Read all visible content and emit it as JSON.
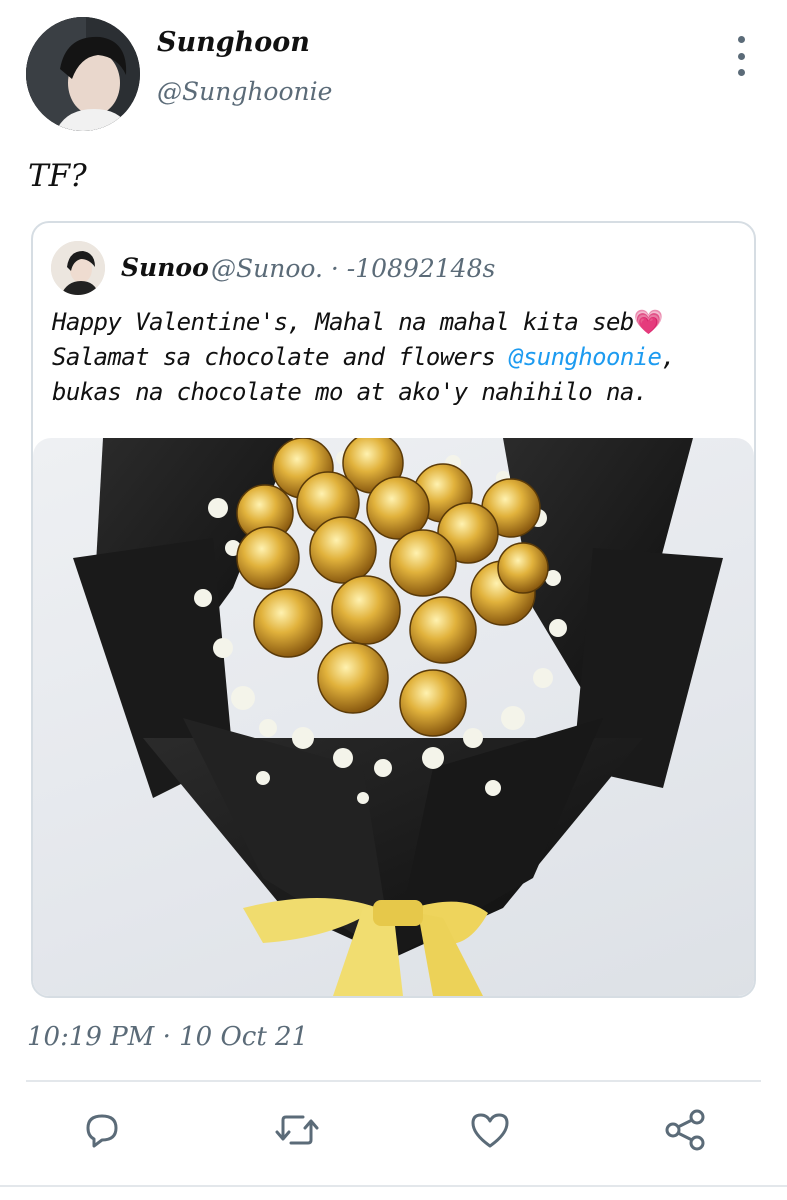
{
  "author": {
    "display_name": "Sunghoon",
    "handle": "@Sunghoonie"
  },
  "tweet": {
    "text": "TF?",
    "timestamp": "10:19 PM · 10 Oct 21"
  },
  "quoted": {
    "display_name": "Sunoo",
    "meta": "@Sunoo. · -10892148s",
    "line1": "Happy Valentine's, Mahal na mahal kita seb",
    "emoji": "💗",
    "line2_start": "Salamat sa chocolate and flowers ",
    "mention": "@sunghoonie",
    "line2_end": ",",
    "line3": "bukas na chocolate mo at ako'y nahihilo na."
  },
  "actions": {
    "reply_icon": "reply-icon",
    "retweet_icon": "retweet-icon",
    "like_icon": "heart-icon",
    "share_icon": "share-icon"
  },
  "colors": {
    "secondary_text": "#5b6b78",
    "link": "#1d9bf0",
    "border": "#d6dde3"
  }
}
